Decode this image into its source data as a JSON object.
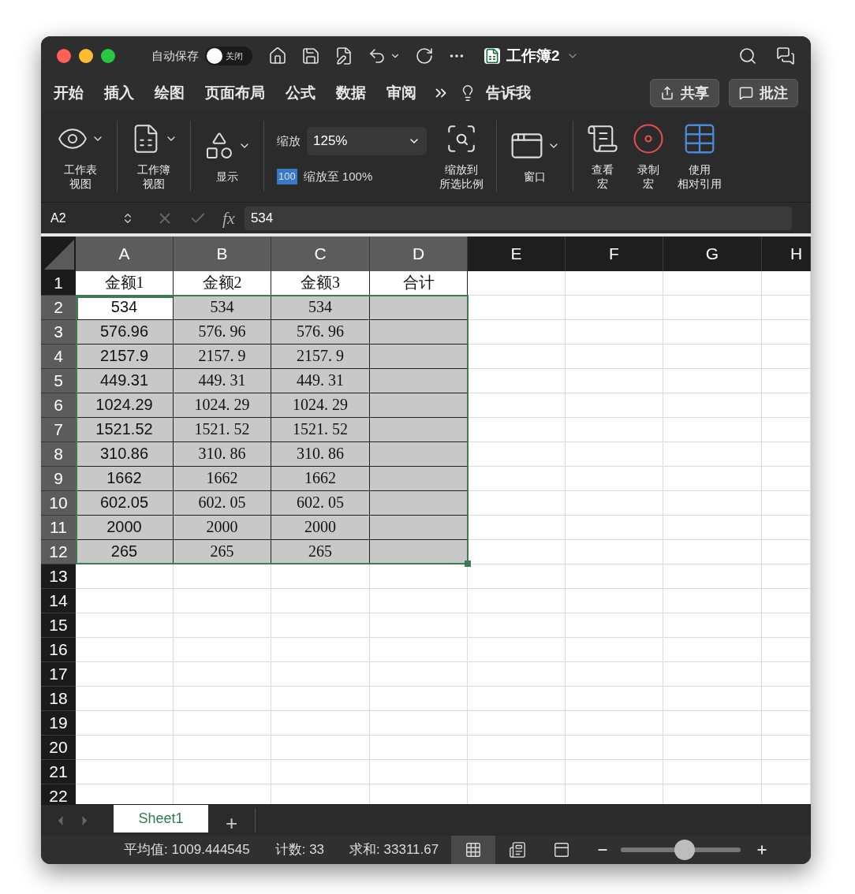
{
  "title_bar": {
    "autosave_label": "自动保存",
    "autosave_switch": {
      "label": "关闭",
      "on": false
    },
    "title": "工作簿2"
  },
  "menu_tabs": [
    "开始",
    "插入",
    "绘图",
    "页面布局",
    "公式",
    "数据",
    "审阅"
  ],
  "tell_me": "告诉我",
  "share_button": "共享",
  "comments_button": "批注",
  "ribbon": {
    "sheet_view": [
      "工作表",
      "视图"
    ],
    "workbook_view": [
      "工作簿",
      "视图"
    ],
    "show": [
      "显示"
    ],
    "zoom": {
      "label": "缩放",
      "value": "125%"
    },
    "zoom_100": {
      "badge": "100",
      "label": "缩放至 100%"
    },
    "zoom_selection": [
      "缩放到",
      "所选比例"
    ],
    "window": [
      "窗口"
    ],
    "macros": [
      [
        "查看",
        "宏"
      ],
      [
        "录制",
        "宏"
      ],
      [
        "使用",
        "相对引用"
      ]
    ]
  },
  "formula_bar": {
    "name_box": "A2",
    "fx": "fx",
    "formula": "534"
  },
  "grid": {
    "columns": [
      {
        "label": "A",
        "selected": true
      },
      {
        "label": "B",
        "selected": true
      },
      {
        "label": "C",
        "selected": true
      },
      {
        "label": "D",
        "selected": true
      },
      {
        "label": "E",
        "selected": false
      },
      {
        "label": "F",
        "selected": false
      },
      {
        "label": "G",
        "selected": false
      },
      {
        "label": "H",
        "selected": false
      }
    ],
    "rows": [
      {
        "number": "1",
        "selected": false,
        "cells": [
          {
            "text": "金额1",
            "active": false
          },
          {
            "text": "金额2",
            "active": false
          },
          {
            "text": "金额3",
            "active": false
          },
          {
            "text": "合计",
            "active": false
          }
        ]
      },
      {
        "number": "2",
        "selected": true,
        "cells": [
          {
            "text": "534",
            "active": true
          },
          {
            "text": "534",
            "active": false
          },
          {
            "text": "534",
            "active": false
          },
          {
            "active": false
          }
        ]
      },
      {
        "number": "3",
        "selected": true,
        "cells": [
          {
            "text": "576.96",
            "active": false
          },
          {
            "text": "576. 96",
            "active": false
          },
          {
            "text": "576. 96",
            "active": false
          },
          {
            "active": false
          }
        ]
      },
      {
        "number": "4",
        "selected": true,
        "cells": [
          {
            "text": "2157.9",
            "active": false
          },
          {
            "text": "2157. 9",
            "active": false
          },
          {
            "text": "2157. 9",
            "active": false
          },
          {
            "active": false
          }
        ]
      },
      {
        "number": "5",
        "selected": true,
        "cells": [
          {
            "text": "449.31",
            "active": false
          },
          {
            "text": "449. 31",
            "active": false
          },
          {
            "text": "449. 31",
            "active": false
          },
          {
            "active": false
          }
        ]
      },
      {
        "number": "6",
        "selected": true,
        "cells": [
          {
            "text": "1024.29",
            "active": false
          },
          {
            "text": "1024. 29",
            "active": false
          },
          {
            "text": "1024. 29",
            "active": false
          },
          {
            "active": false
          }
        ]
      },
      {
        "number": "7",
        "selected": true,
        "cells": [
          {
            "text": "1521.52",
            "active": false
          },
          {
            "text": "1521. 52",
            "active": false
          },
          {
            "text": "1521. 52",
            "active": false
          },
          {
            "active": false
          }
        ]
      },
      {
        "number": "8",
        "selected": true,
        "cells": [
          {
            "text": "310.86",
            "active": false
          },
          {
            "text": "310. 86",
            "active": false
          },
          {
            "text": "310. 86",
            "active": false
          },
          {
            "active": false
          }
        ]
      },
      {
        "number": "9",
        "selected": true,
        "cells": [
          {
            "text": "1662",
            "active": false
          },
          {
            "text": "1662",
            "active": false
          },
          {
            "text": "1662",
            "active": false
          },
          {
            "active": false
          }
        ]
      },
      {
        "number": "10",
        "selected": true,
        "cells": [
          {
            "text": "602.05",
            "active": false
          },
          {
            "text": "602. 05",
            "active": false
          },
          {
            "text": "602. 05",
            "active": false
          },
          {
            "active": false
          }
        ]
      },
      {
        "number": "11",
        "selected": true,
        "cells": [
          {
            "text": "2000",
            "active": false
          },
          {
            "text": "2000",
            "active": false
          },
          {
            "text": "2000",
            "active": false
          },
          {
            "active": false
          }
        ]
      },
      {
        "number": "12",
        "selected": true,
        "cells": [
          {
            "text": "265",
            "active": false
          },
          {
            "text": "265",
            "active": false
          },
          {
            "text": "265",
            "active": false
          },
          {
            "active": false
          }
        ]
      },
      {
        "number": "13",
        "selected": false
      },
      {
        "number": "14",
        "selected": false
      },
      {
        "number": "15",
        "selected": false
      },
      {
        "number": "16",
        "selected": false
      },
      {
        "number": "17",
        "selected": false
      },
      {
        "number": "18",
        "selected": false
      },
      {
        "number": "19",
        "selected": false
      },
      {
        "number": "20",
        "selected": false
      },
      {
        "number": "21",
        "selected": false
      },
      {
        "number": "22",
        "selected": false
      }
    ]
  },
  "sheet_tabs": [
    {
      "label": "Sheet1",
      "selected": true
    }
  ],
  "add_sheet": "+",
  "status_bar": {
    "average": "平均值: 1009.444545",
    "count": "计数: 33",
    "sum": "求和: 33311.67",
    "views": [
      {
        "selected": true
      },
      {
        "selected": false
      },
      {
        "selected": false
      }
    ],
    "zoom_slider": {
      "level": 0.53
    }
  }
}
